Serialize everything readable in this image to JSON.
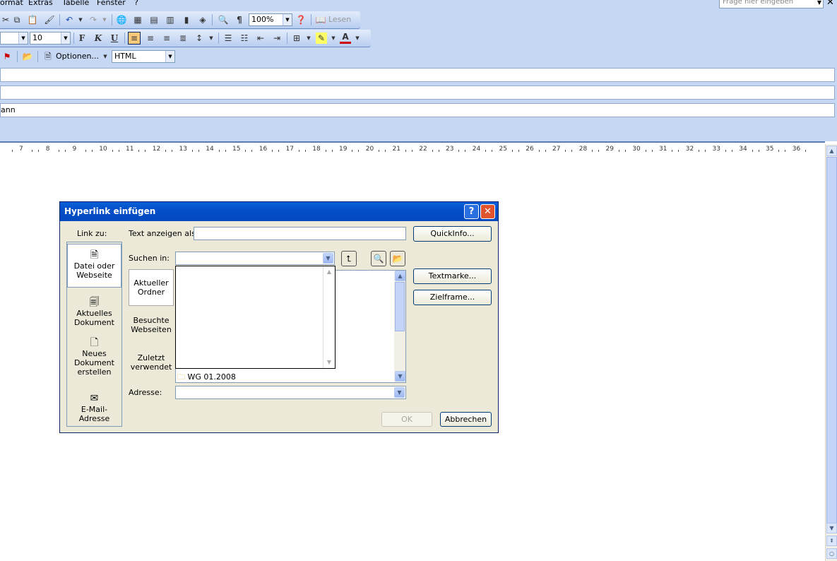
{
  "menubar": {
    "items": [
      "ormat",
      "Extras",
      "Tabelle",
      "Fenster",
      "?"
    ],
    "help_placeholder": "Frage hier eingeben"
  },
  "toolbar1": {
    "zoom": "100%",
    "read_label": "Lesen",
    "pilcrow": "¶"
  },
  "toolbar2": {
    "font_size": "10",
    "bold": "F",
    "italic": "K",
    "underline": "U",
    "font_color_letter": "A"
  },
  "toolbar3": {
    "options_label": "Optionen...",
    "format_value": "HTML"
  },
  "header_fields": {
    "field3_value": "ann"
  },
  "ruler": {
    "labels": [
      "7",
      "8",
      "9",
      "10",
      "11",
      "12",
      "13",
      "14",
      "15",
      "16",
      "17",
      "18",
      "19",
      "20",
      "21",
      "22",
      "23",
      "24",
      "25",
      "26",
      "27",
      "28",
      "29",
      "30",
      "31",
      "32",
      "33",
      "34",
      "35",
      "36"
    ]
  },
  "dialog": {
    "title": "Hyperlink einfügen",
    "help_btn": "?",
    "close_btn": "✕",
    "link_to_label": "Link zu:",
    "linkbar": [
      {
        "l1": "Datei oder",
        "l2": "Webseite",
        "l3": ""
      },
      {
        "l1": "Aktuelles",
        "l2": "Dokument",
        "l3": ""
      },
      {
        "l1": "Neues",
        "l2": "Dokument",
        "l3": "erstellen"
      },
      {
        "l1": "E-Mail-Adresse",
        "l2": "",
        "l3": ""
      }
    ],
    "text_label": "Text anzeigen als:",
    "text_value": "",
    "quickinfo_btn": "QuickInfo...",
    "lookin_label": "Suchen in:",
    "lookin_value": "",
    "subnav": [
      {
        "l1": "Aktueller",
        "l2": "Ordner"
      },
      {
        "l1": "Besuchte",
        "l2": "Webseiten"
      },
      {
        "l1": "Zuletzt",
        "l2": "verwendet"
      }
    ],
    "file_item": "WG 01.2008",
    "bookmark_btn": "Textmarke...",
    "targetframe_btn": "Zielframe...",
    "address_label": "Adresse:",
    "address_value": "",
    "ok_btn": "OK",
    "cancel_btn": "Abbrechen"
  }
}
